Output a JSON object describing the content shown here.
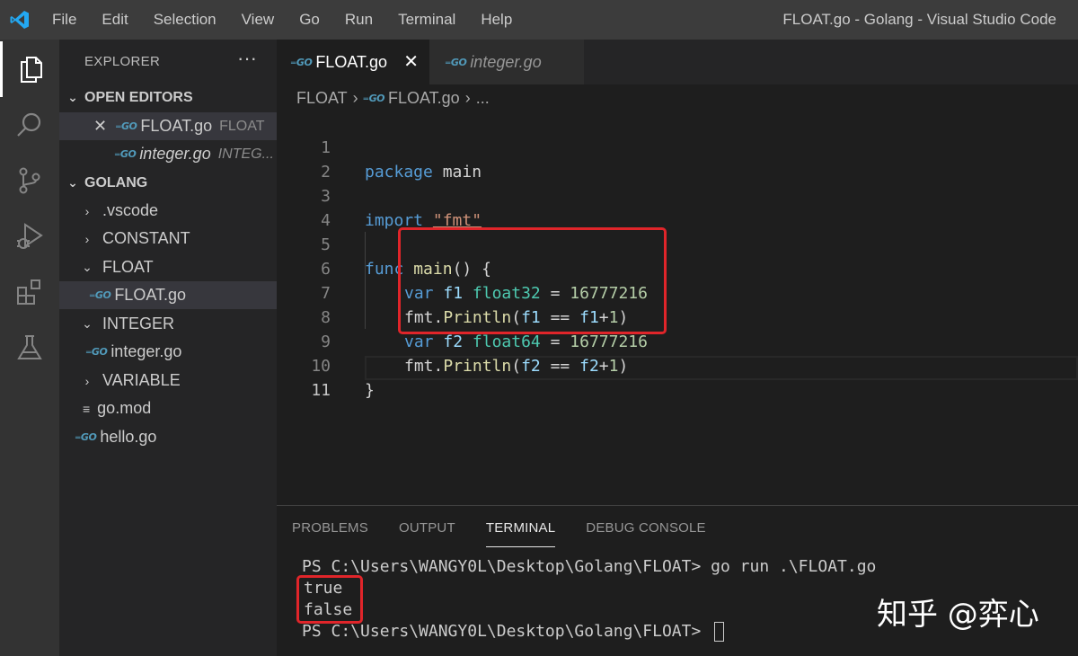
{
  "window": {
    "title": "FLOAT.go - Golang - Visual Studio Code"
  },
  "menu": [
    "File",
    "Edit",
    "Selection",
    "View",
    "Go",
    "Run",
    "Terminal",
    "Help"
  ],
  "activity_bar": [
    {
      "icon": "files-icon",
      "active": true
    },
    {
      "icon": "search-icon",
      "active": false
    },
    {
      "icon": "source-control-icon",
      "active": false
    },
    {
      "icon": "run-debug-icon",
      "active": false
    },
    {
      "icon": "extensions-icon",
      "active": false
    },
    {
      "icon": "testing-icon",
      "active": false
    }
  ],
  "sidebar": {
    "title": "EXPLORER",
    "more": "···",
    "open_editors": {
      "label": "OPEN EDITORS",
      "items": [
        {
          "name": "FLOAT.go",
          "folder": "FLOAT",
          "active": true
        },
        {
          "name": "integer.go",
          "folder": "INTEG..."
        }
      ]
    },
    "workspace": {
      "label": "GOLANG",
      "items": [
        {
          "name": ".vscode"
        },
        {
          "name": "CONSTANT"
        },
        {
          "name": "FLOAT"
        },
        {
          "name": "FLOAT.go"
        },
        {
          "name": "INTEGER"
        },
        {
          "name": "integer.go"
        },
        {
          "name": "VARIABLE"
        },
        {
          "name": "go.mod"
        },
        {
          "name": "hello.go"
        }
      ]
    }
  },
  "tabs": [
    {
      "label": "FLOAT.go",
      "active": true,
      "close": "✕"
    },
    {
      "label": "integer.go",
      "active": false
    }
  ],
  "breadcrumb": {
    "folder": "FLOAT",
    "file": "FLOAT.go",
    "tail": "..."
  },
  "editor": {
    "line_numbers": [
      "1",
      "2",
      "3",
      "4",
      "5",
      "6",
      "7",
      "8",
      "9",
      "10",
      "11"
    ],
    "code": {
      "l1_kw": "package",
      "l1_name": "main",
      "l3_kw": "import",
      "l3_str": "\"fmt\"",
      "l5_kw": "func",
      "l5_fn": "main",
      "l5_rest": "() {",
      "l6_kw": "var",
      "l6_var": "f1",
      "l6_type": "float32",
      "l6_eq": " = ",
      "l6_num": "16777216",
      "l7_pkg": "fmt.",
      "l7_fn": "Println",
      "l7_open": "(",
      "l7_a": "f1",
      "l7_op": " == ",
      "l7_b": "f1",
      "l7_plus": "+",
      "l7_one": "1",
      "l7_close": ")",
      "l8_kw": "var",
      "l8_var": "f2",
      "l8_type": "float64",
      "l8_eq": " = ",
      "l8_num": "16777216",
      "l9_pkg": "fmt.",
      "l9_fn": "Println",
      "l9_open": "(",
      "l9_a": "f2",
      "l9_op": " == ",
      "l9_b": "f2",
      "l9_plus": "+",
      "l9_one": "1",
      "l9_close": ")",
      "l10": "}"
    }
  },
  "panel": {
    "tabs": [
      "PROBLEMS",
      "OUTPUT",
      "TERMINAL",
      "DEBUG CONSOLE"
    ],
    "active_tab": "TERMINAL",
    "terminal": {
      "line1": "PS C:\\Users\\WANGY0L\\Desktop\\Golang\\FLOAT> go run .\\FLOAT.go",
      "line2": "true",
      "line3": "false",
      "line4": "PS C:\\Users\\WANGY0L\\Desktop\\Golang\\FLOAT> "
    }
  },
  "watermark": "知乎 @弈心",
  "colors": {
    "highlight_box": "#e0252a",
    "keyword": "#569cd6",
    "function": "#dcdcaa",
    "type": "#4ec9b0",
    "number": "#b5cea8",
    "string": "#ce9178"
  }
}
